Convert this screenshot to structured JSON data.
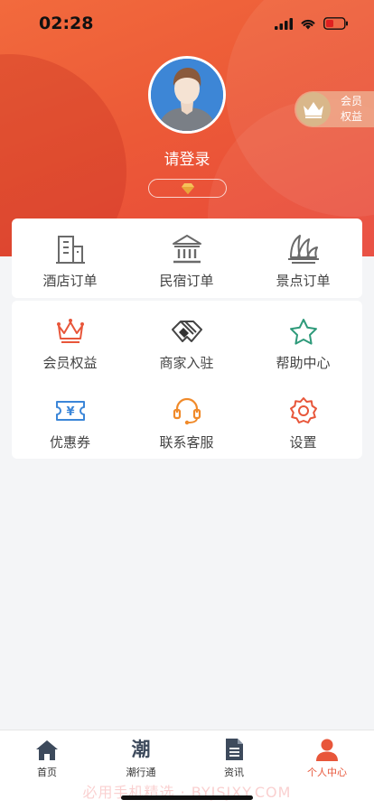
{
  "status_bar": {
    "time": "02:28"
  },
  "profile": {
    "login_text": "请登录"
  },
  "member_badge": {
    "label": "会员权益"
  },
  "orders": [
    {
      "label": "酒店订单",
      "icon": "hotel-icon"
    },
    {
      "label": "民宿订单",
      "icon": "bank-icon"
    },
    {
      "label": "景点订单",
      "icon": "opera-house-icon"
    }
  ],
  "services": [
    {
      "label": "会员权益",
      "icon": "crown-icon",
      "color": "#e8563a"
    },
    {
      "label": "商家入驻",
      "icon": "handshake-icon",
      "color": "#555555"
    },
    {
      "label": "帮助中心",
      "icon": "star-icon",
      "color": "#2e9a7a"
    },
    {
      "label": "优惠券",
      "icon": "coupon-icon",
      "color": "#3b86d8"
    },
    {
      "label": "联系客服",
      "icon": "headset-icon",
      "color": "#f08a2a"
    },
    {
      "label": "设置",
      "icon": "gear-icon",
      "color": "#e8563a"
    }
  ],
  "tabs": [
    {
      "label": "首页",
      "icon": "home-icon"
    },
    {
      "label": "潮行通",
      "icon": "chao-icon",
      "glyph": "潮"
    },
    {
      "label": "资讯",
      "icon": "news-icon"
    },
    {
      "label": "个人中心",
      "icon": "user-icon",
      "active": true
    }
  ],
  "colors": {
    "accent": "#e8563a",
    "hero_top": "#f26a3d",
    "hero_bottom": "#e8473a"
  },
  "watermark": "必用手机精选 · BYJSJXY.COM"
}
